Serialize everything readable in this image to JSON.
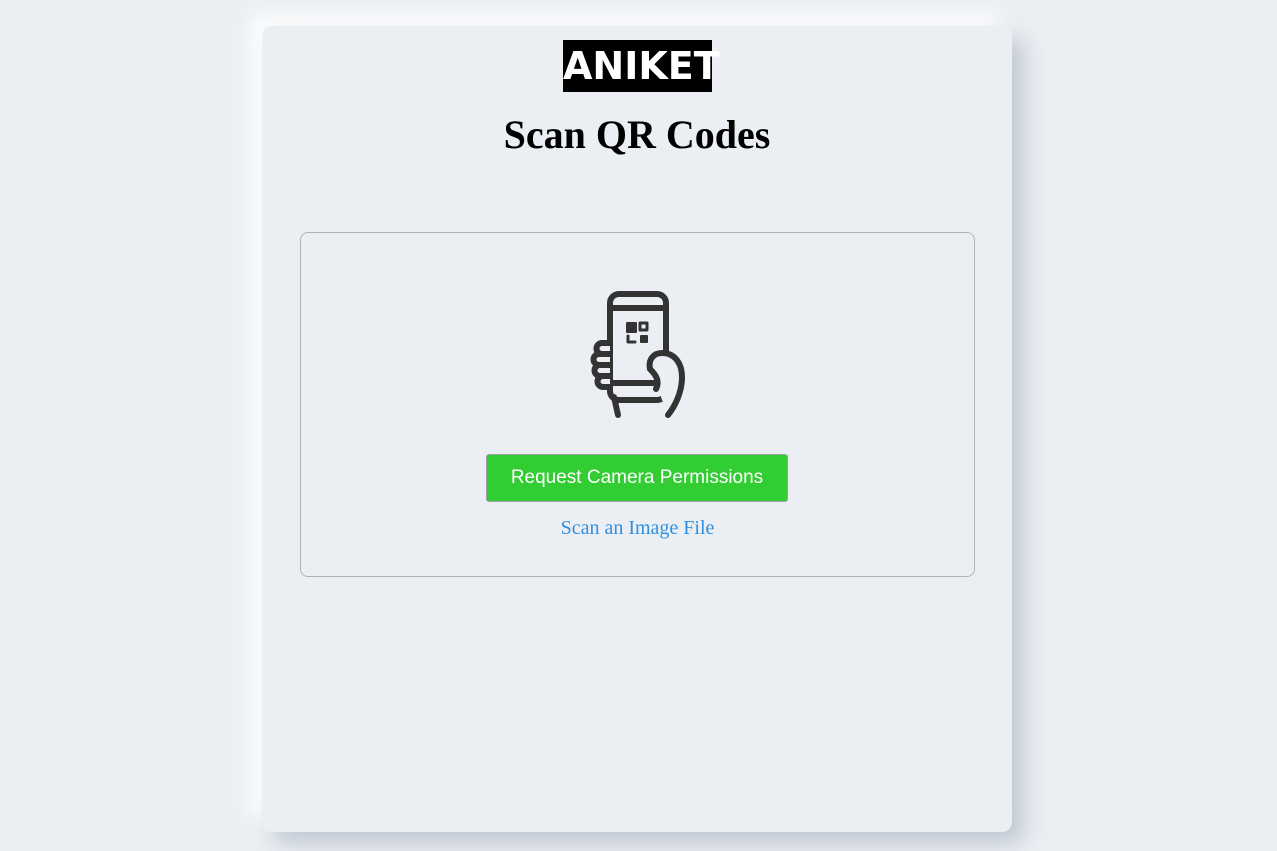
{
  "header": {
    "logo_text": "ANIKET",
    "title": "Scan QR Codes"
  },
  "scanner": {
    "icon": "phone-qr-scan-icon",
    "permission_button_label": "Request Camera Permissions",
    "file_link_label": "Scan an Image File"
  },
  "colors": {
    "background": "#ebeff3",
    "button": "#32cd32",
    "link": "#2f8fe0",
    "icon": "#333333"
  }
}
